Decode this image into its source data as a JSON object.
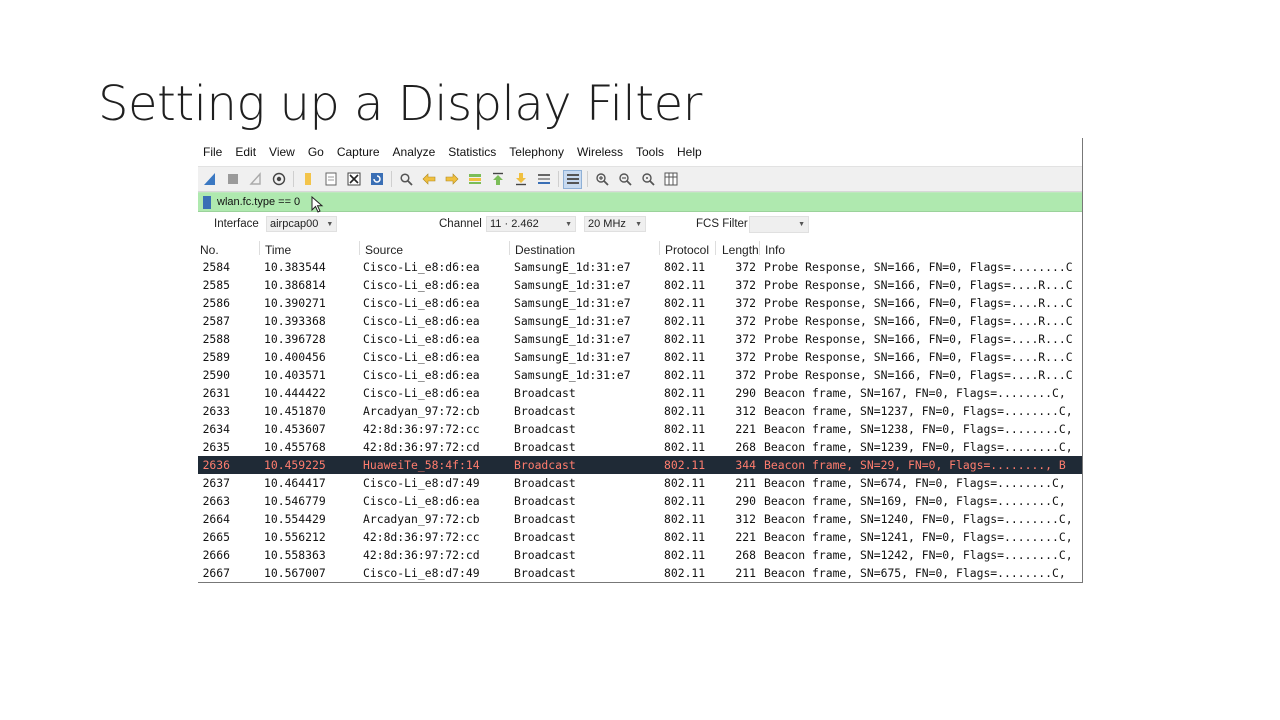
{
  "slide": {
    "title": "Setting up a Display Filter"
  },
  "menu": [
    "File",
    "Edit",
    "View",
    "Go",
    "Capture",
    "Analyze",
    "Statistics",
    "Telephony",
    "Wireless",
    "Tools",
    "Help"
  ],
  "filter": {
    "value": "wlan.fc.type == 0"
  },
  "interface_bar": {
    "interface_label": "Interface",
    "interface_value": "airpcap00",
    "channel_label": "Channel",
    "channel_value": "11 · 2.462",
    "width_value": "20 MHz",
    "fcs_label": "FCS Filter",
    "fcs_value": ""
  },
  "columns": [
    "No.",
    "Time",
    "Source",
    "Destination",
    "Protocol",
    "Length",
    "Info"
  ],
  "packets": [
    {
      "no": "2584",
      "time": "10.383544",
      "src": "Cisco-Li_e8:d6:ea",
      "dst": "SamsungE_1d:31:e7",
      "proto": "802.11",
      "len": "372",
      "info": "Probe Response, SN=166, FN=0, Flags=........C"
    },
    {
      "no": "2585",
      "time": "10.386814",
      "src": "Cisco-Li_e8:d6:ea",
      "dst": "SamsungE_1d:31:e7",
      "proto": "802.11",
      "len": "372",
      "info": "Probe Response, SN=166, FN=0, Flags=....R...C"
    },
    {
      "no": "2586",
      "time": "10.390271",
      "src": "Cisco-Li_e8:d6:ea",
      "dst": "SamsungE_1d:31:e7",
      "proto": "802.11",
      "len": "372",
      "info": "Probe Response, SN=166, FN=0, Flags=....R...C"
    },
    {
      "no": "2587",
      "time": "10.393368",
      "src": "Cisco-Li_e8:d6:ea",
      "dst": "SamsungE_1d:31:e7",
      "proto": "802.11",
      "len": "372",
      "info": "Probe Response, SN=166, FN=0, Flags=....R...C"
    },
    {
      "no": "2588",
      "time": "10.396728",
      "src": "Cisco-Li_e8:d6:ea",
      "dst": "SamsungE_1d:31:e7",
      "proto": "802.11",
      "len": "372",
      "info": "Probe Response, SN=166, FN=0, Flags=....R...C"
    },
    {
      "no": "2589",
      "time": "10.400456",
      "src": "Cisco-Li_e8:d6:ea",
      "dst": "SamsungE_1d:31:e7",
      "proto": "802.11",
      "len": "372",
      "info": "Probe Response, SN=166, FN=0, Flags=....R...C"
    },
    {
      "no": "2590",
      "time": "10.403571",
      "src": "Cisco-Li_e8:d6:ea",
      "dst": "SamsungE_1d:31:e7",
      "proto": "802.11",
      "len": "372",
      "info": "Probe Response, SN=166, FN=0, Flags=....R...C"
    },
    {
      "no": "2631",
      "time": "10.444422",
      "src": "Cisco-Li_e8:d6:ea",
      "dst": "Broadcast",
      "proto": "802.11",
      "len": "290",
      "info": "Beacon frame, SN=167, FN=0, Flags=........C,"
    },
    {
      "no": "2633",
      "time": "10.451870",
      "src": "Arcadyan_97:72:cb",
      "dst": "Broadcast",
      "proto": "802.11",
      "len": "312",
      "info": "Beacon frame, SN=1237, FN=0, Flags=........C,"
    },
    {
      "no": "2634",
      "time": "10.453607",
      "src": "42:8d:36:97:72:cc",
      "dst": "Broadcast",
      "proto": "802.11",
      "len": "221",
      "info": "Beacon frame, SN=1238, FN=0, Flags=........C,"
    },
    {
      "no": "2635",
      "time": "10.455768",
      "src": "42:8d:36:97:72:cd",
      "dst": "Broadcast",
      "proto": "802.11",
      "len": "268",
      "info": "Beacon frame, SN=1239, FN=0, Flags=........C,"
    },
    {
      "no": "2636",
      "time": "10.459225",
      "src": "HuaweiTe_58:4f:14",
      "dst": "Broadcast",
      "proto": "802.11",
      "len": "344",
      "info": "Beacon frame, SN=29, FN=0, Flags=........, B",
      "selected": true
    },
    {
      "no": "2637",
      "time": "10.464417",
      "src": "Cisco-Li_e8:d7:49",
      "dst": "Broadcast",
      "proto": "802.11",
      "len": "211",
      "info": "Beacon frame, SN=674, FN=0, Flags=........C,"
    },
    {
      "no": "2663",
      "time": "10.546779",
      "src": "Cisco-Li_e8:d6:ea",
      "dst": "Broadcast",
      "proto": "802.11",
      "len": "290",
      "info": "Beacon frame, SN=169, FN=0, Flags=........C,"
    },
    {
      "no": "2664",
      "time": "10.554429",
      "src": "Arcadyan_97:72:cb",
      "dst": "Broadcast",
      "proto": "802.11",
      "len": "312",
      "info": "Beacon frame, SN=1240, FN=0, Flags=........C,"
    },
    {
      "no": "2665",
      "time": "10.556212",
      "src": "42:8d:36:97:72:cc",
      "dst": "Broadcast",
      "proto": "802.11",
      "len": "221",
      "info": "Beacon frame, SN=1241, FN=0, Flags=........C,"
    },
    {
      "no": "2666",
      "time": "10.558363",
      "src": "42:8d:36:97:72:cd",
      "dst": "Broadcast",
      "proto": "802.11",
      "len": "268",
      "info": "Beacon frame, SN=1242, FN=0, Flags=........C,"
    },
    {
      "no": "2667",
      "time": "10.567007",
      "src": "Cisco-Li_e8:d7:49",
      "dst": "Broadcast",
      "proto": "802.11",
      "len": "211",
      "info": "Beacon frame, SN=675, FN=0, Flags=........C,"
    }
  ],
  "colors": {
    "filter_ok": "#afe9af",
    "selected_row_bg": "#1f2a36",
    "selected_row_fg": "#ff7d6e"
  },
  "toolbar_icons": [
    "shark-fin-start-icon",
    "stop-icon",
    "restart-icon",
    "options-icon",
    "open-folder-icon",
    "file-icon",
    "close-file-icon",
    "reload-icon",
    "find-icon",
    "back-icon",
    "forward-icon",
    "go-to-packet-icon",
    "first-packet-icon",
    "last-packet-icon",
    "autoscroll-icon",
    "colorize-icon",
    "zoom-in-icon",
    "zoom-out-icon",
    "normal-size-icon",
    "resize-columns-icon"
  ]
}
